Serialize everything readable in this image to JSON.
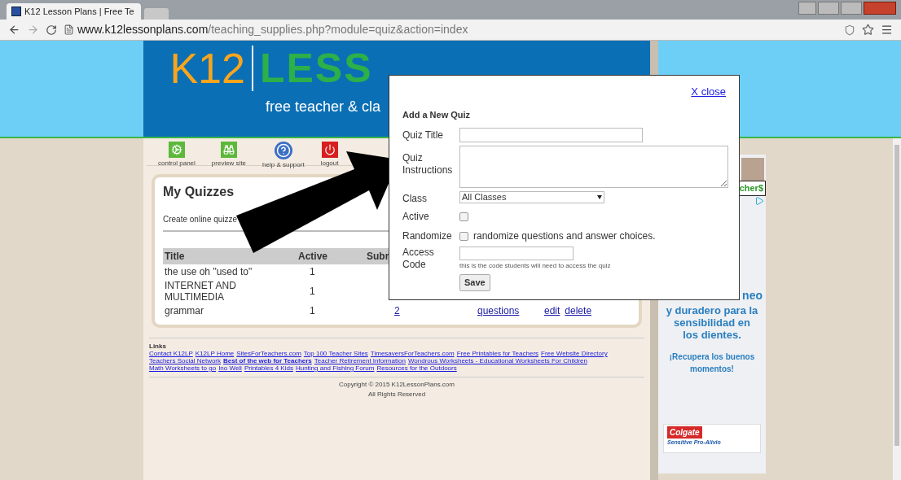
{
  "browser": {
    "tab_title": "K12 Lesson Plans | Free Te",
    "url_host": "www.k12lessonplans.com",
    "url_path": "/teaching_supplies.php?module=quiz&action=index"
  },
  "header": {
    "logo_left": "K12",
    "logo_right": "LESS",
    "tagline": "free teacher & cla"
  },
  "toolbar": [
    {
      "label": "control panel",
      "kind": "gears"
    },
    {
      "label": "preview site",
      "kind": "binoculars"
    },
    {
      "label": "help & support",
      "kind": "help"
    },
    {
      "label": "logout",
      "kind": "power"
    }
  ],
  "quizzes": {
    "title": "My Quizzes",
    "intro": "Create online quizze",
    "columns": [
      "Title",
      "Active",
      "Subr"
    ],
    "rows": [
      {
        "title": "the use oh \"used to\"",
        "active": "1"
      },
      {
        "title": "INTERNET AND MULTIMEDIA",
        "active": "1"
      },
      {
        "title": "grammar",
        "active": "1",
        "submissions": "2",
        "questions": "questions",
        "edit": "edit",
        "delete": "delete"
      }
    ]
  },
  "links": {
    "heading": "Links",
    "items": [
      {
        "text": "Contact K12LP",
        "bold": false
      },
      {
        "text": "K12LP Home",
        "bold": false
      },
      {
        "text": "SitesForTeachers.com",
        "bold": false
      },
      {
        "text": "Top 100 Teacher Sites",
        "bold": false
      },
      {
        "text": "TimesaversForTeachers.com",
        "bold": false
      },
      {
        "text": "Free Printables for Teachers",
        "bold": false
      },
      {
        "text": "Free Website Directory",
        "bold": false
      },
      {
        "text": "Teachers Social Network",
        "bold": false
      },
      {
        "text": "Best of the web for Teachers",
        "bold": true
      },
      {
        "text": "Teacher Retirement Information",
        "bold": false
      },
      {
        "text": "Wondrous Worksheets - Educational Worksheets For Children",
        "bold": false
      },
      {
        "text": "Math Worksheets to go",
        "bold": false
      },
      {
        "text": "Ino Well",
        "bold": false
      },
      {
        "text": "Printables 4 Kids",
        "bold": false
      },
      {
        "text": "Hunting and Fishing Forum",
        "bold": false
      },
      {
        "text": "Resources for the Outdoors",
        "bold": false
      }
    ]
  },
  "copyright": [
    "Copyright © 2015 K12LessonPlans.com",
    "All Rights Reserved"
  ],
  "ad": {
    "banner_text": "cher$",
    "partial": "neo",
    "lines": [
      "y duradero para la",
      "sensibilidad en",
      "los dientes."
    ],
    "slogan": "¡Recupera los buenos momentos!",
    "brand": "Colgate",
    "product": "Sensitive Pro-Alivio"
  },
  "modal": {
    "close": "X close",
    "title": "Add a New Quiz",
    "title_label": "Quiz Title",
    "instructions_label": "Quiz Instructions",
    "class_label": "Class",
    "class_value": "All Classes",
    "active_label": "Active",
    "active_checked": false,
    "randomize_label": "Randomize",
    "randomize_checked": false,
    "randomize_text": "randomize questions and answer choices.",
    "access_label": "Access Code",
    "access_hint": "this is the code students will need to access the quiz",
    "save": "Save"
  }
}
